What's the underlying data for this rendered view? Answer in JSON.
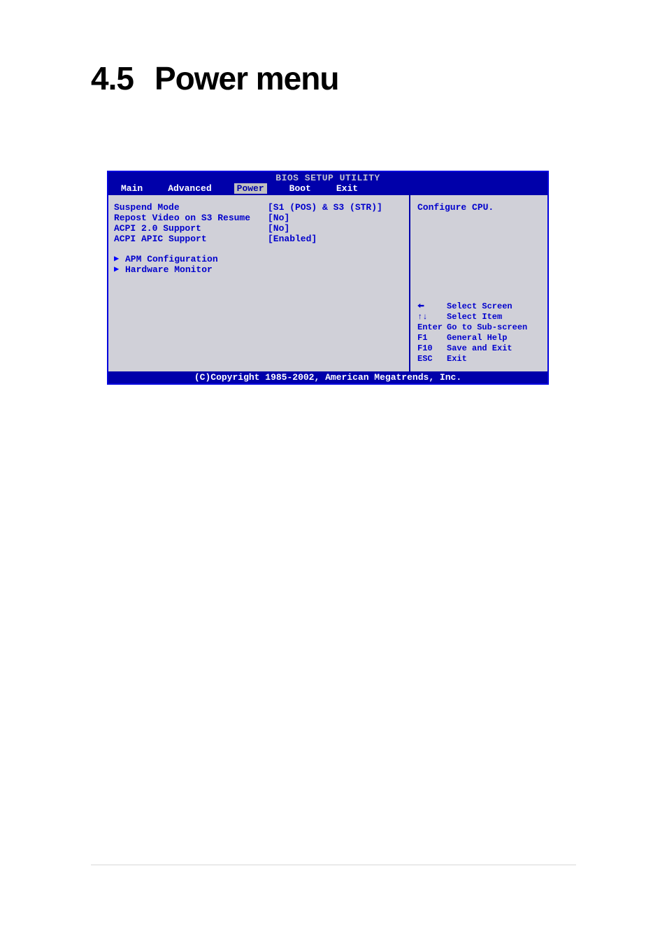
{
  "page": {
    "heading_number": "4.5",
    "heading_title": "Power menu"
  },
  "bios": {
    "title": "BIOS SETUP UTILITY",
    "tabs": [
      "Main",
      "Advanced",
      "Power",
      "Boot",
      "Exit"
    ],
    "active_tab": "Power",
    "settings": [
      {
        "label": "Suspend Mode",
        "value": "[S1 (POS) & S3 (STR)]"
      },
      {
        "label": "Repost Video on S3 Resume",
        "value": "[No]"
      },
      {
        "label": "ACPI 2.0 Support",
        "value": "[No]"
      },
      {
        "label": "ACPI APIC Support",
        "value": "[Enabled]"
      }
    ],
    "submenus": [
      {
        "label": "APM Configuration"
      },
      {
        "label": "Hardware Monitor"
      }
    ],
    "help_text": "Configure CPU.",
    "key_help": [
      {
        "key": "←",
        "action": "Select Screen",
        "icon": "arrow-left"
      },
      {
        "key": "↑↓",
        "action": "Select Item",
        "icon": "arrow-updown"
      },
      {
        "key": "Enter",
        "action": "Go to Sub-screen"
      },
      {
        "key": "F1",
        "action": "General Help"
      },
      {
        "key": "F10",
        "action": "Save and Exit"
      },
      {
        "key": "ESC",
        "action": "Exit"
      }
    ],
    "footer": "(C)Copyright 1985-2002, American Megatrends, Inc."
  }
}
